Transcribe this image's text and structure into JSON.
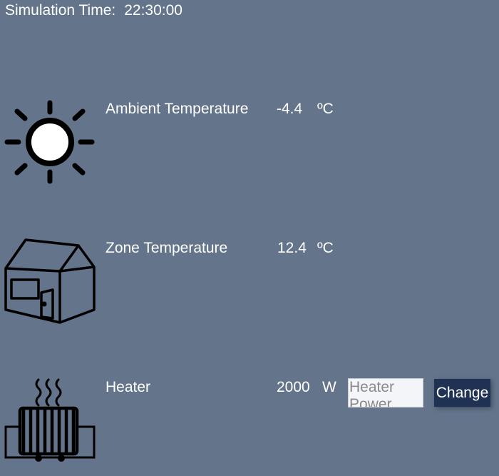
{
  "simulation": {
    "time_label": "Simulation Time:",
    "time_value": "22:30:00"
  },
  "ambient": {
    "icon": "sun-icon",
    "label": "Ambient Temperature",
    "value": "-4.4",
    "unit": "ºC"
  },
  "zone": {
    "icon": "house-icon",
    "label": "Zone Temperature",
    "value": "12.4",
    "unit": "ºC"
  },
  "heater": {
    "icon": "heater-icon",
    "label": "Heater",
    "value": "2000",
    "unit": "W",
    "input_placeholder": "Heater Power",
    "change_label": "Change"
  },
  "colors": {
    "background": "#63748b",
    "button": "#1f3254",
    "text": "#ffffff"
  }
}
